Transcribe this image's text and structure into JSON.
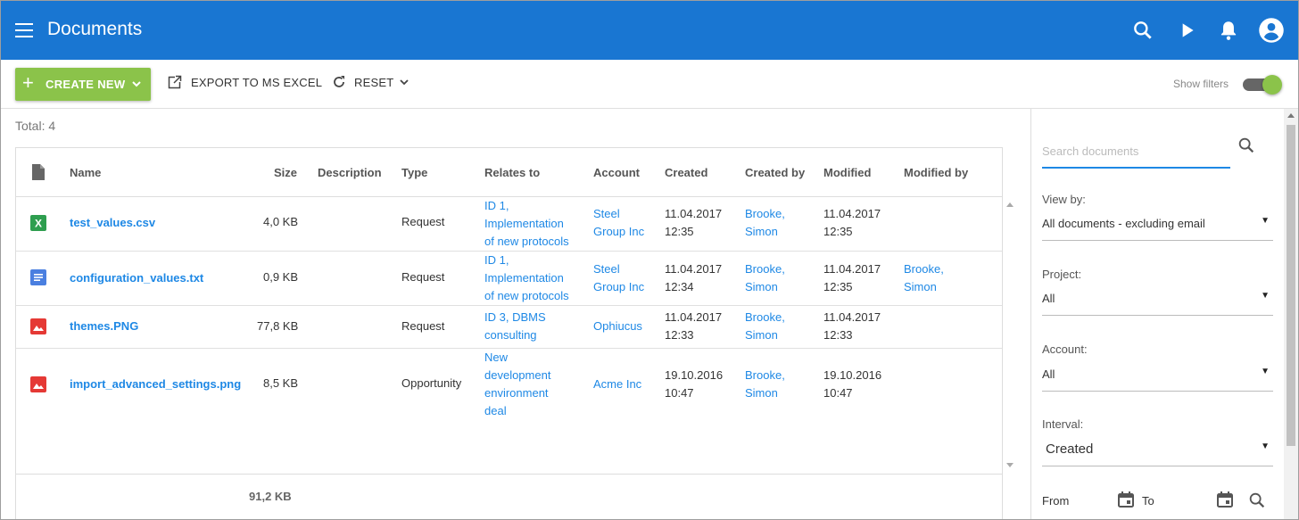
{
  "header": {
    "title": "Documents",
    "bg_color": "#1976d2",
    "icons": [
      "menu-icon",
      "search-icon",
      "play-icon",
      "bell-icon",
      "account-icon"
    ]
  },
  "toolbar": {
    "create_label": "CREATE NEW",
    "export_label": "EXPORT TO MS EXCEL",
    "reset_label": "RESET",
    "show_filters_label": "Show filters",
    "show_filters_on": true,
    "accent_color": "#8bc34a"
  },
  "main": {
    "total_label": "Total: 4",
    "columns": [
      "Name",
      "Size",
      "Description",
      "Type",
      "Relates to",
      "Account",
      "Created",
      "Created by",
      "Modified",
      "Modified by"
    ],
    "rows": [
      {
        "icon": "excel-icon",
        "name": "test_values.csv",
        "size": "4,0 KB",
        "description": "",
        "type": "Request",
        "relates_to": [
          "ID 1,",
          "Implementation",
          "of new protocols"
        ],
        "account": [
          "Steel",
          "Group Inc"
        ],
        "created": [
          "11.04.2017",
          "12:35"
        ],
        "created_by": [
          "Brooke,",
          "Simon"
        ],
        "modified": [
          "11.04.2017",
          "12:35"
        ],
        "modified_by": []
      },
      {
        "icon": "text-file-icon",
        "name": "configuration_values.txt",
        "size": "0,9 KB",
        "description": "",
        "type": "Request",
        "relates_to": [
          "ID 1,",
          "Implementation",
          "of new protocols"
        ],
        "account": [
          "Steel",
          "Group Inc"
        ],
        "created": [
          "11.04.2017",
          "12:34"
        ],
        "created_by": [
          "Brooke,",
          "Simon"
        ],
        "modified": [
          "11.04.2017",
          "12:35"
        ],
        "modified_by": [
          "Brooke,",
          "Simon"
        ]
      },
      {
        "icon": "image-file-icon",
        "name": "themes.PNG",
        "size": "77,8 KB",
        "description": "",
        "type": "Request",
        "relates_to": [
          "ID 3, DBMS",
          "consulting"
        ],
        "account": [
          "Ophiucus"
        ],
        "created": [
          "11.04.2017",
          "12:33"
        ],
        "created_by": [
          "Brooke,",
          "Simon"
        ],
        "modified": [
          "11.04.2017",
          "12:33"
        ],
        "modified_by": []
      },
      {
        "icon": "image-file-icon",
        "name": "import_advanced_settings.png",
        "size": "8,5 KB",
        "description": "",
        "type": "Opportunity",
        "relates_to": [
          "New",
          "development",
          "environment",
          "deal"
        ],
        "account": [
          "Acme Inc"
        ],
        "created": [
          "19.10.2016",
          "10:47"
        ],
        "created_by": [
          "Brooke,",
          "Simon"
        ],
        "modified": [
          "19.10.2016",
          "10:47"
        ],
        "modified_by": []
      }
    ],
    "size_total": "91,2 KB"
  },
  "filters": {
    "search_placeholder": "Search documents",
    "view_by_label": "View by:",
    "view_by_value": "All documents - excluding email",
    "project_label": "Project:",
    "project_value": "All",
    "account_label": "Account:",
    "account_value": "All",
    "interval_label": "Interval:",
    "interval_value": "Created",
    "from_label": "From",
    "to_label": "To"
  }
}
